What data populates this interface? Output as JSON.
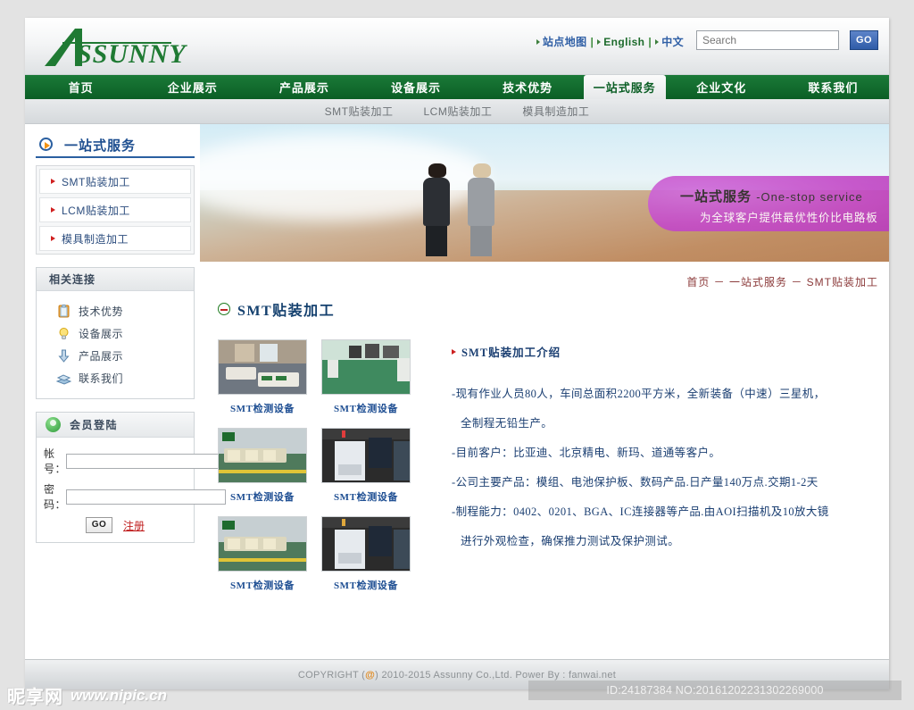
{
  "header": {
    "logo_text": "ASSUNNY",
    "top_links": [
      {
        "label": "站点地图",
        "style": "blue"
      },
      {
        "label": "English",
        "style": "green"
      },
      {
        "label": "中文",
        "style": "blue"
      }
    ],
    "search": {
      "placeholder": "Search",
      "value": "",
      "button_label": "GO"
    }
  },
  "nav": {
    "items": [
      {
        "label": "首页",
        "active": false
      },
      {
        "label": "企业展示",
        "active": false
      },
      {
        "label": "产品展示",
        "active": false
      },
      {
        "label": "设备展示",
        "active": false
      },
      {
        "label": "技术优势",
        "active": false
      },
      {
        "label": "一站式服务",
        "active": true
      },
      {
        "label": "企业文化",
        "active": false
      },
      {
        "label": "联系我们",
        "active": false
      }
    ],
    "subitems": [
      {
        "label": "SMT贴装加工"
      },
      {
        "label": "LCM贴装加工"
      },
      {
        "label": "模具制造加工"
      }
    ]
  },
  "sidebar": {
    "section_title": "一站式服务",
    "items": [
      {
        "label": "SMT贴装加工"
      },
      {
        "label": "LCM贴装加工"
      },
      {
        "label": "模具制造加工"
      }
    ],
    "related": {
      "title": "相关连接",
      "links": [
        {
          "label": "技术优势",
          "icon": "clipboard-icon"
        },
        {
          "label": "设备展示",
          "icon": "lightbulb-icon"
        },
        {
          "label": "产品展示",
          "icon": "download-arrow-icon"
        },
        {
          "label": "联系我们",
          "icon": "book-icon"
        }
      ]
    },
    "login": {
      "title": "会员登陆",
      "account_label": "帐号：",
      "account_value": "",
      "password_label": "密码：",
      "password_value": "",
      "submit_label": "GO",
      "register_label": "注册"
    }
  },
  "banner": {
    "headline_cn": "一站式服务",
    "headline_en": "-One-stop service",
    "subline": "为全球客户提供最优性价比电路板"
  },
  "main": {
    "breadcrumb": "首页 － 一站式服务 － SMT贴装加工",
    "page_title": "SMT贴装加工",
    "article_heading": "SMT贴装加工介绍",
    "paragraphs": [
      "-现有作业人员80人，车间总面积2200平方米，全新装备（中速）三星机，",
      "全制程无铅生产。",
      "-目前客户：比亚迪、北京精电、新玛、道通等客户。",
      "-公司主要产品：模组、电池保护板、数码产品.日产量140万点.交期1-2天",
      "-制程能力：0402、0201、BGA、IC连接器等产品.由AOI扫描机及10放大镜",
      "进行外观检查，确保推力测试及保护测试。"
    ],
    "thumbnails": [
      {
        "caption": "SMT检测设备"
      },
      {
        "caption": "SMT检测设备"
      },
      {
        "caption": "SMT检测设备"
      },
      {
        "caption": "SMT检测设备"
      },
      {
        "caption": "SMT检测设备"
      },
      {
        "caption": "SMT检测设备"
      }
    ]
  },
  "footer": {
    "copyright_prefix": "COPYRIGHT (",
    "copyright_at": "@",
    "copyright_suffix": ") 2010-2015 Assunny Co.,Ltd.   Power By : fanwai.net"
  },
  "watermarks": {
    "id_text": "ID:24187384 NO:20161202231302269000",
    "site_zh": "昵享网",
    "site_en": "www.nipic.cn"
  },
  "colors": {
    "brand_green": "#0b5e25",
    "accent_blue": "#2a5fa0",
    "bubble_pink": "#c44cc8",
    "crumb_red": "#8b3a3a"
  }
}
